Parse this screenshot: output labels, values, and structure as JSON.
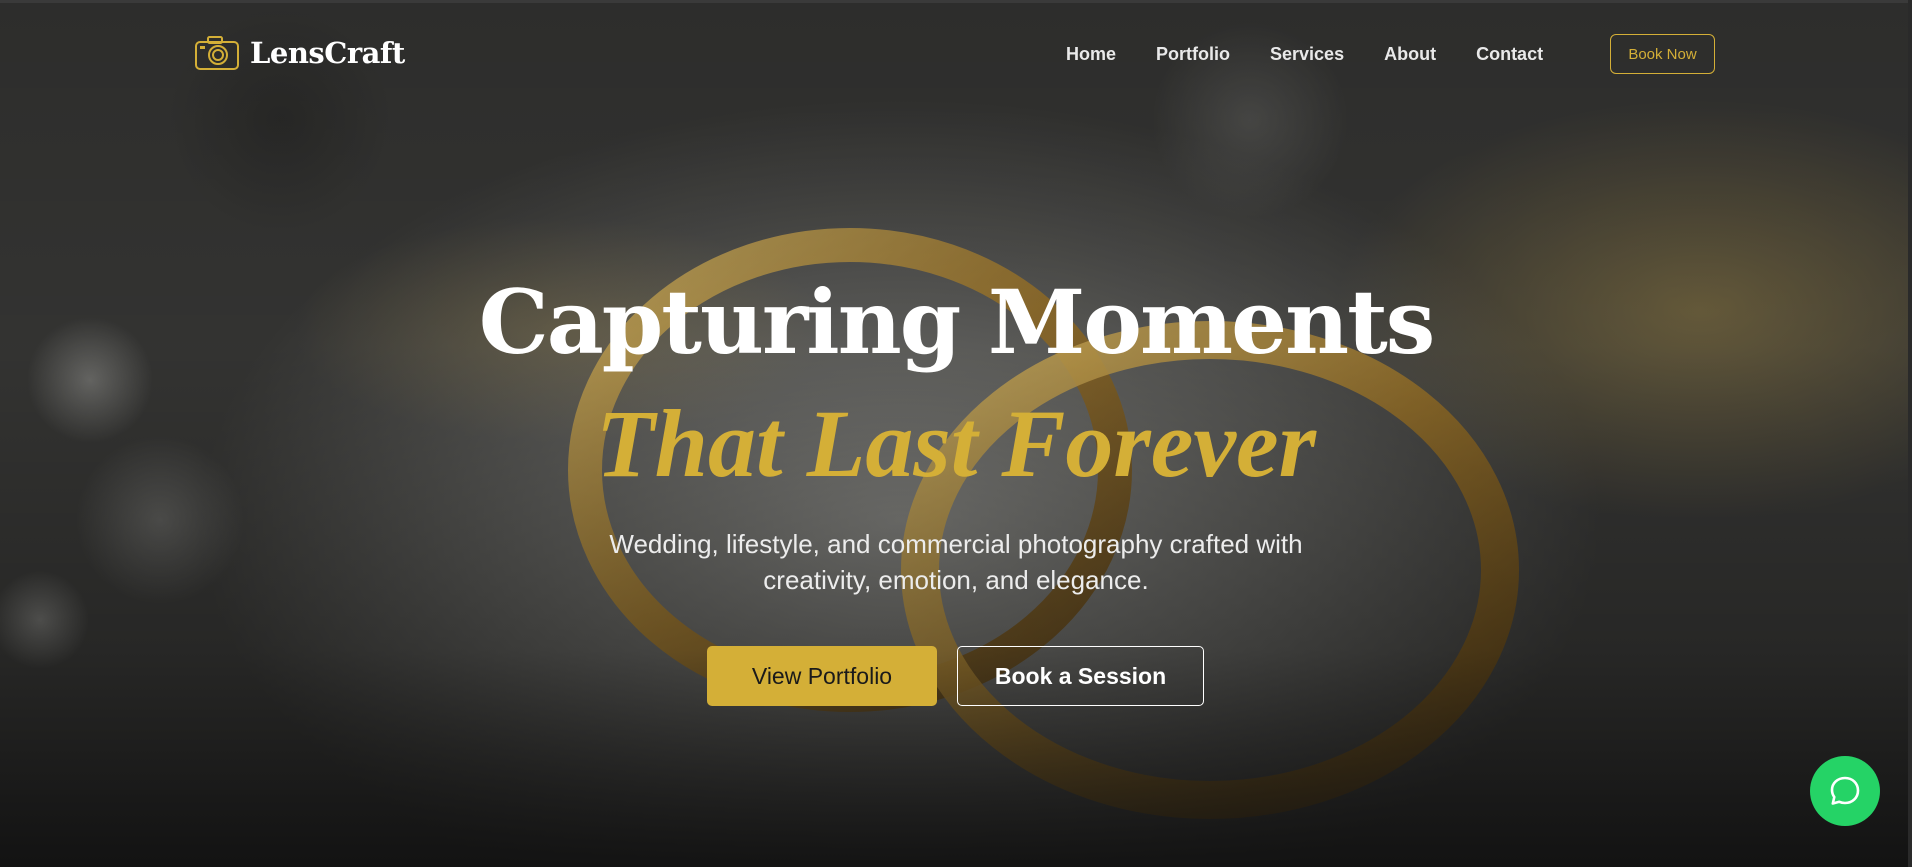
{
  "brand": {
    "name": "LensCraft",
    "icon": "camera-icon",
    "accent": "#d4af37"
  },
  "nav": {
    "links": [
      "Home",
      "Portfolio",
      "Services",
      "About",
      "Contact"
    ],
    "cta": "Book Now"
  },
  "hero": {
    "headline_1": "Capturing Moments",
    "headline_2": "That Last Forever",
    "subtext": "Wedding, lifestyle, and commercial photography crafted with creativity, emotion, and elegance.",
    "primary_button": "View Portfolio",
    "secondary_button": "Book a Session"
  },
  "chat": {
    "icon": "chat-bubble-icon",
    "color": "#25d366"
  }
}
